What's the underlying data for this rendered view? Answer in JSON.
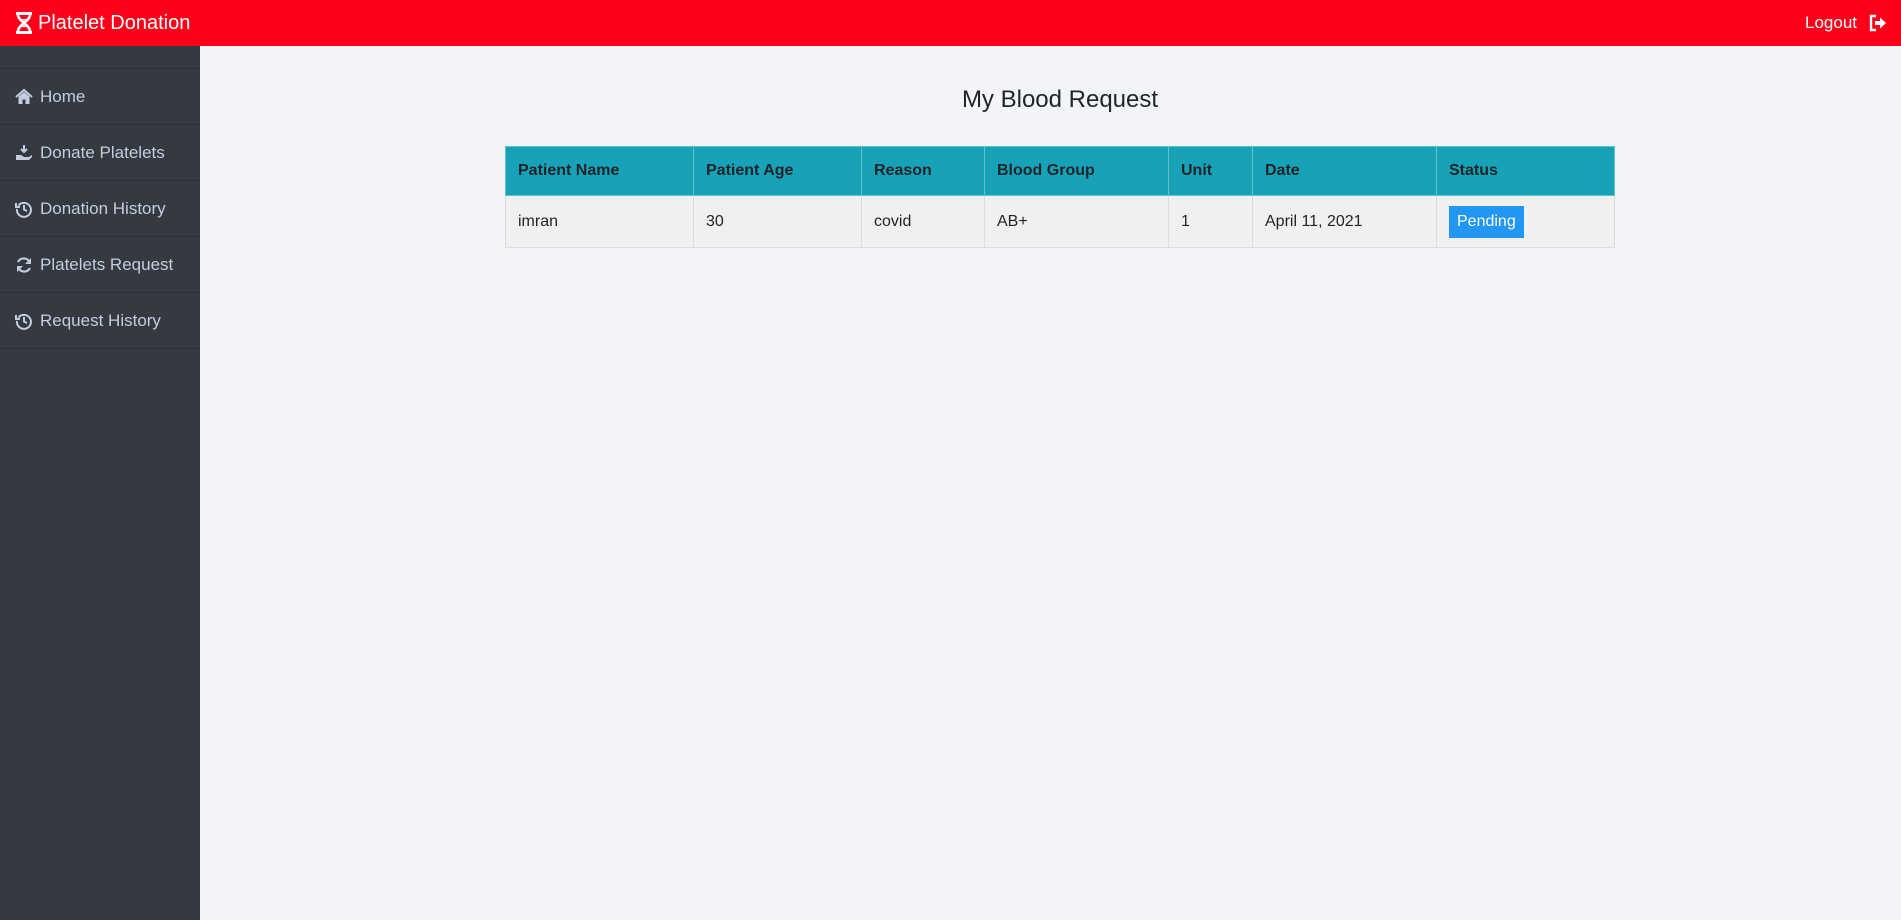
{
  "header": {
    "brand": "Platelet Donation",
    "logout_label": "Logout"
  },
  "sidebar": {
    "items": [
      {
        "label": "Home",
        "icon": "home-icon"
      },
      {
        "label": "Donate Platelets",
        "icon": "hand-donate-icon"
      },
      {
        "label": "Donation History",
        "icon": "history-icon"
      },
      {
        "label": "Platelets Request",
        "icon": "refresh-icon"
      },
      {
        "label": "Request History",
        "icon": "history-icon"
      }
    ]
  },
  "main": {
    "title": "My Blood Request",
    "table": {
      "headers": [
        "Patient Name",
        "Patient Age",
        "Reason",
        "Blood Group",
        "Unit",
        "Date",
        "Status"
      ],
      "rows": [
        {
          "patient_name": "imran",
          "patient_age": "30",
          "reason": "covid",
          "blood_group": "AB+",
          "unit": "1",
          "date": "April 11, 2021",
          "status": "Pending"
        }
      ]
    }
  },
  "colors": {
    "topbar": "#ff001a",
    "sidebar": "#343a40",
    "table_header": "#17a2b8",
    "status_pending": "#2196f3"
  }
}
